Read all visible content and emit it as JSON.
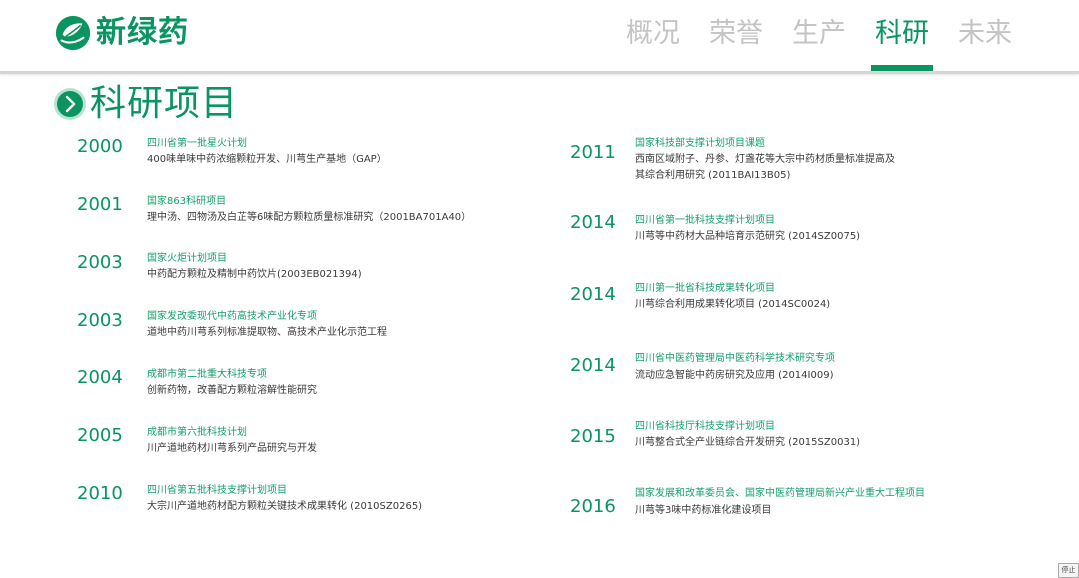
{
  "brand": {
    "name": "新绿药",
    "color": "#0a9460",
    "logo_icon": "leaf-hands-icon"
  },
  "nav": {
    "items": [
      {
        "label": "概况"
      },
      {
        "label": "荣誉"
      },
      {
        "label": "生产"
      },
      {
        "label": "科研"
      },
      {
        "label": "未来"
      }
    ],
    "active": "科研"
  },
  "section": {
    "title": "科研项目",
    "icon": "chevron-right-circle-icon"
  },
  "left_entries": [
    {
      "year": "2000",
      "title": "四川省第一批星火计划",
      "desc": [
        "400味单味中药浓缩颗粒开发、川芎生产基地（GAP）"
      ]
    },
    {
      "year": "2001",
      "title": "国家863科研项目",
      "desc": [
        "理中汤、四物汤及白芷等6味配方颗粒质量标准研究（2001BA701A40）"
      ]
    },
    {
      "year": "2003",
      "title": "国家火炬计划项目",
      "desc": [
        "中药配方颗粒及精制中药饮片(2003EB021394)"
      ]
    },
    {
      "year": "2003",
      "title": "国家发改委现代中药高技术产业化专项",
      "desc": [
        "道地中药川芎系列标准提取物、高技术产业化示范工程"
      ]
    },
    {
      "year": "2004",
      "title": "成都市第二批重大科技专项",
      "desc": [
        "创新药物，改善配方颗粒溶解性能研究"
      ]
    },
    {
      "year": "2005",
      "title": "成都市第六批科技计划",
      "desc": [
        "川产道地药材川芎系列产品研究与开发"
      ]
    },
    {
      "year": "2010",
      "title": "四川省第五批科技支撑计划项目",
      "desc": [
        "大宗川产道地药材配方颗粒关键技术成果转化 (2010SZ0265)"
      ]
    }
  ],
  "right_entries": [
    {
      "year": "2011",
      "title": "国家科技部支撑计划项目课题",
      "desc": [
        "西南区域附子、丹参、灯盏花等大宗中药材质量标准提高及",
        "其综合利用研究 (2011BAI13B05)"
      ]
    },
    {
      "year": "2014",
      "title": "四川省第一批科技支撑计划项目",
      "desc": [
        "川芎等中药材大品种培育示范研究 (2014SZ0075)"
      ]
    },
    {
      "year": "2014",
      "title": "四川第一批省科技成果转化项目",
      "desc": [
        "川芎综合利用成果转化项目 (2014SC0024)"
      ]
    },
    {
      "year": "2014",
      "title": "四川省中医药管理局中医药科学技术研究专项",
      "desc": [
        "流动应急智能中药房研究及应用 (2014I009)"
      ]
    },
    {
      "year": "2015",
      "title": "四川省科技厅科技支撑计划项目",
      "desc": [
        "川芎整合式全产业链综合开发研究 (2015SZ0031)"
      ]
    },
    {
      "year": "2016",
      "title": "国家发展和改革委员会、国家中医药管理局新兴产业重大工程项目",
      "desc": [
        "川芎等3味中药标准化建设项目"
      ]
    }
  ],
  "controls": {
    "stop_label": "停止"
  }
}
